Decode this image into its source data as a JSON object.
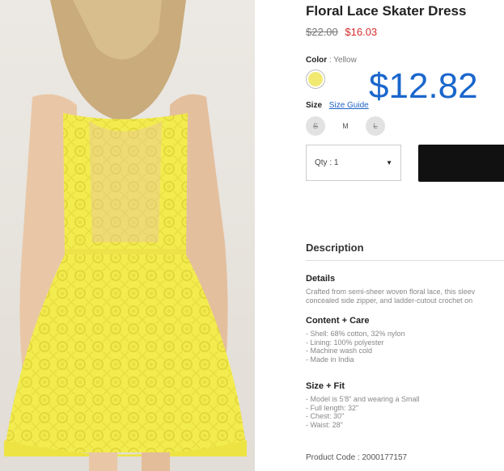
{
  "product": {
    "title": "Floral Lace Skater Dress",
    "original_price": "$22.00",
    "sale_price": "$16.03",
    "overlay_price": "$12.82"
  },
  "color": {
    "label": "Color",
    "separator": " : ",
    "value": "Yellow",
    "swatch_hex": "#f2e973"
  },
  "size": {
    "label": "Size",
    "guide_link": "Size Guide",
    "options": [
      {
        "label": "S",
        "available": false
      },
      {
        "label": "M",
        "available": true
      },
      {
        "label": "L",
        "available": false
      }
    ]
  },
  "quantity": {
    "label": "Qty : 1"
  },
  "description": {
    "heading": "Description",
    "details_heading": "Details",
    "details_line1": "Crafted from semi-sheer woven floral lace, this sleev",
    "details_line2": "concealed side zipper, and ladder-cutout crochet on",
    "content_heading": "Content + Care",
    "content_items": [
      "- Shell: 68% cotton, 32% nylon",
      "- Lining: 100% polyester",
      "- Machine wash cold",
      "- Made in India"
    ],
    "fit_heading": "Size + Fit",
    "fit_items": [
      "- Model is 5'8\" and wearing a Small",
      "- Full length: 32\"",
      "- Chest: 30\"",
      "- Waist: 28\""
    ],
    "product_code": "Product Code : 2000177157"
  },
  "colors": {
    "sale_red": "#d52b2b",
    "link_blue": "#1e64c8",
    "overlay_blue": "#1a66cc",
    "button_black": "#111111"
  }
}
